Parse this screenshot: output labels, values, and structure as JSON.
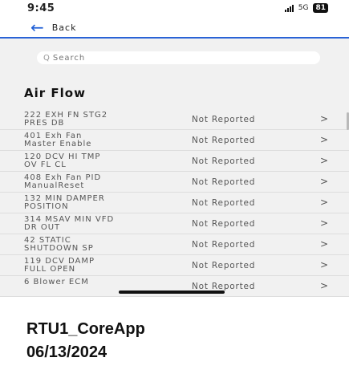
{
  "status_bar": {
    "time": "9:45",
    "network": "5G",
    "battery": "81"
  },
  "nav": {
    "back_label": "Back",
    "back_icon": "arrow-left-icon"
  },
  "search": {
    "placeholder": "Search"
  },
  "section": {
    "title": "Air Flow"
  },
  "rows": [
    {
      "name_line1": "222 EXH FN STG2",
      "name_line2": "PRES DB",
      "status": "Not Reported",
      "chevron": ">"
    },
    {
      "name_line1": "401 Exh Fan",
      "name_line2": "Master Enable",
      "status": "Not Reported",
      "chevron": ">"
    },
    {
      "name_line1": "120 DCV HI TMP",
      "name_line2": "OV FL CL",
      "status": "Not Reported",
      "chevron": ">"
    },
    {
      "name_line1": "408 Exh Fan PID",
      "name_line2": "ManualReset",
      "status": "Not Reported",
      "chevron": ">"
    },
    {
      "name_line1": "132 MIN DAMPER",
      "name_line2": "POSITION",
      "status": "Not Reported",
      "chevron": ">"
    },
    {
      "name_line1": "314 MSAV MIN VFD",
      "name_line2": "DR OUT",
      "status": "Not Reported",
      "chevron": ">"
    },
    {
      "name_line1": "42 STATIC",
      "name_line2": "SHUTDOWN SP",
      "status": "Not Reported",
      "chevron": ">"
    },
    {
      "name_line1": "119 DCV DAMP",
      "name_line2": "FULL OPEN",
      "status": "Not Reported",
      "chevron": ">"
    },
    {
      "name_line1": "6 Blower ECM",
      "name_line2": "",
      "status": "Not Reported",
      "chevron": ">"
    }
  ],
  "caption": {
    "line1": "RTU1_CoreApp",
    "line2": "06/13/2024"
  }
}
